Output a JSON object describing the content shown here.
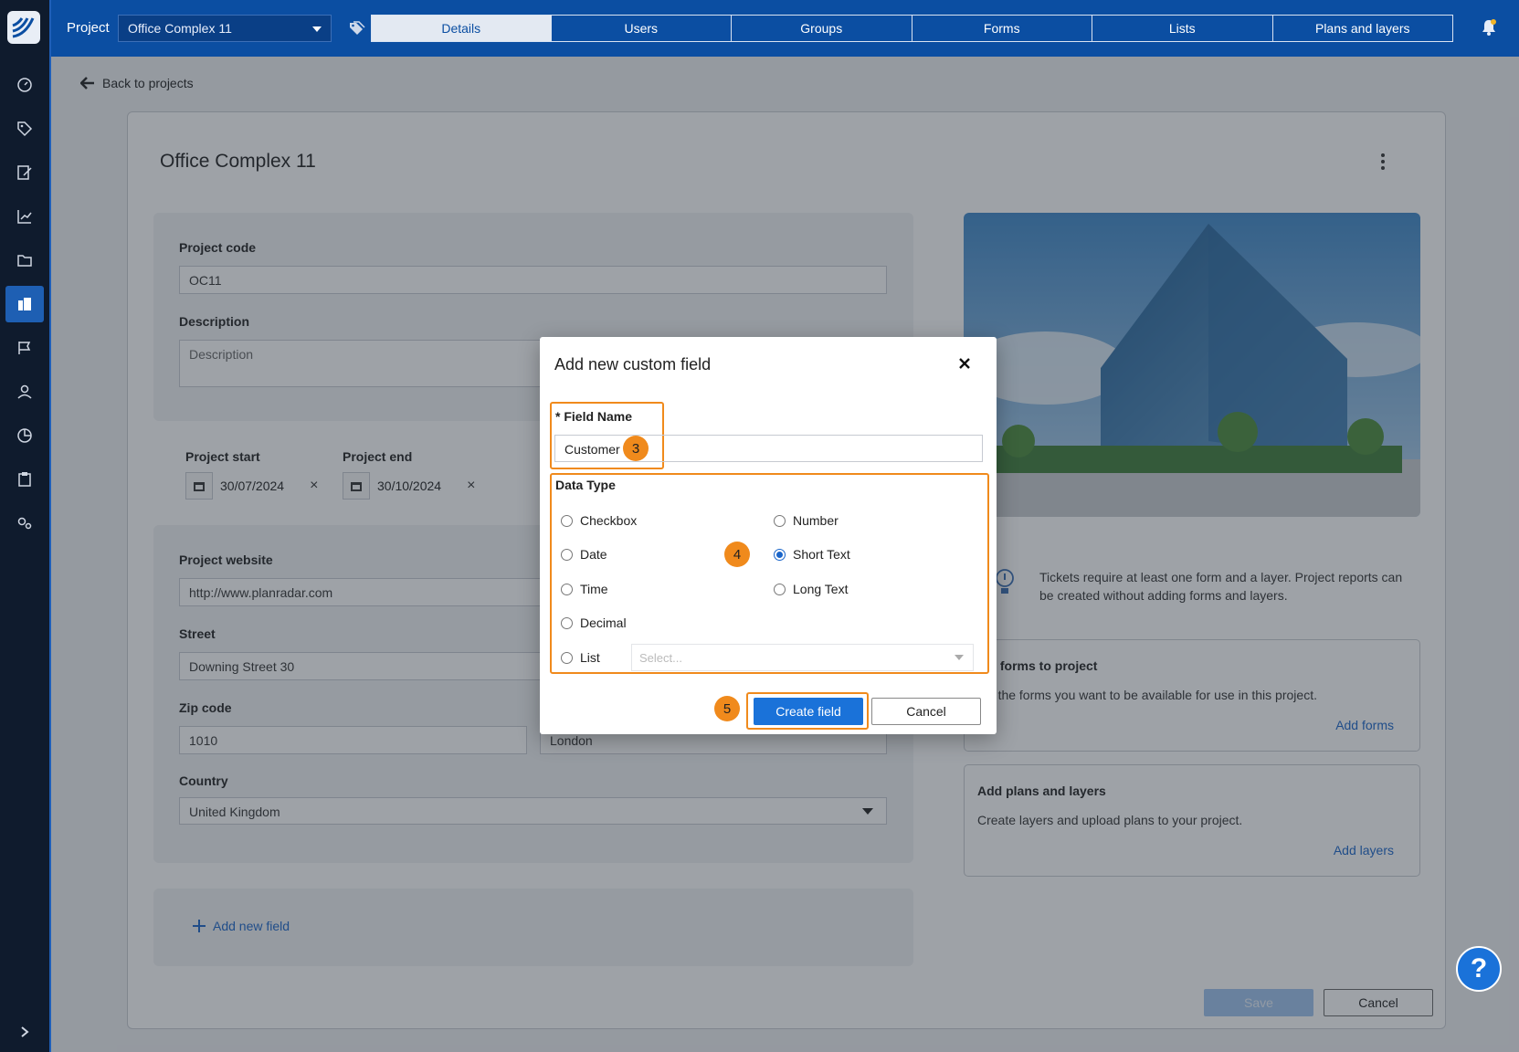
{
  "topbar": {
    "project_label": "Project",
    "project_selected": "Office Complex 11",
    "tabs": [
      "Details",
      "Users",
      "Groups",
      "Forms",
      "Lists",
      "Plans and layers"
    ],
    "active_tab": "Details"
  },
  "page": {
    "back_link": "Back to projects",
    "title": "Office Complex 11",
    "project_code_label": "Project code",
    "project_code_value": "OC11",
    "description_label": "Description",
    "description_placeholder": "Description",
    "project_start_label": "Project start",
    "project_start_value": "30/07/2024",
    "project_end_label": "Project end",
    "project_end_value": "30/10/2024",
    "website_label": "Project website",
    "website_value": "http://www.planradar.com",
    "street_label": "Street",
    "street_value": "Downing Street 30",
    "zip_label": "Zip code",
    "zip_value": "1010",
    "city_value": "London",
    "country_label": "Country",
    "country_value": "United Kingdom",
    "add_new_field": "Add new field",
    "save_label": "Save",
    "cancel_label": "Cancel",
    "help_label": "?"
  },
  "side": {
    "tip": "Tickets require at least one form and a layer. Project reports can be created without adding forms and layers.",
    "forms_title": "ign forms to project",
    "forms_desc": "ect the forms you want to be available for use in this project.",
    "forms_action": "Add forms",
    "layers_title": "Add plans and layers",
    "layers_desc": "Create layers and upload plans to your project.",
    "layers_action": "Add layers"
  },
  "modal": {
    "title": "Add new custom field",
    "field_name_label": "* Field Name",
    "field_name_value": "Customer",
    "data_type_label": "Data Type",
    "options_left": [
      "Checkbox",
      "Date",
      "Time",
      "Decimal",
      "List"
    ],
    "options_right": [
      "Number",
      "Short Text",
      "Long Text"
    ],
    "selected": "Short Text",
    "list_placeholder": "Select...",
    "create_label": "Create field",
    "cancel_label": "Cancel",
    "step_badges": [
      "3",
      "4",
      "5"
    ]
  },
  "colors": {
    "primary": "#0b4ea2",
    "accent_button": "#1a72d9",
    "highlight": "#f08a1c",
    "sidebar": "#0f1b2d"
  }
}
